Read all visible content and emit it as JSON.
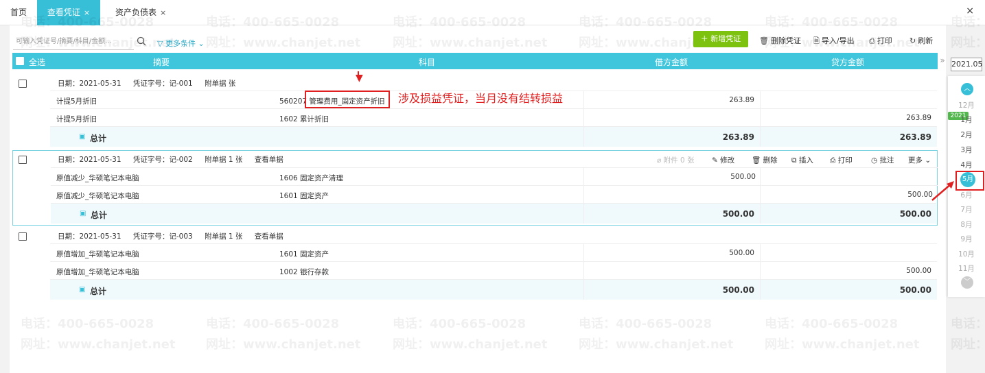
{
  "tabs": {
    "home": "首页",
    "active": "查看凭证",
    "balance_sheet": "资产负债表",
    "close_glyph": "×"
  },
  "toolbar": {
    "search_placeholder": "可输入凭证号/摘要/科目/金额...",
    "more_conditions": "更多条件",
    "new_voucher": "＋ 新增凭证",
    "delete_voucher": "删除凭证",
    "import_export": "导入/导出",
    "print": "打印",
    "refresh": "刷新"
  },
  "table_header": {
    "select_all": "全选",
    "summary": "摘要",
    "account": "科目",
    "debit": "借方金额",
    "credit": "贷方金额"
  },
  "vouchers": [
    {
      "date": "日期：2021-05-31",
      "number": "凭证字号：记-001",
      "attach": "附单据  张",
      "view": "",
      "rows": [
        {
          "summary": "计提5月折旧",
          "account": "560207 管理费用_固定资产折旧",
          "debit": "263.89",
          "credit": ""
        },
        {
          "summary": "计提5月折旧",
          "account": "1602 累计折旧",
          "debit": "",
          "credit": "263.89"
        }
      ],
      "total_label": "总计",
      "total_debit": "263.89",
      "total_credit": "263.89"
    },
    {
      "date": "日期：2021-05-31",
      "number": "凭证字号：记-002",
      "attach": "附单据 1 张",
      "view": "查看单据",
      "rows": [
        {
          "summary": "原值减少_华硕笔记本电脑",
          "account": "1606 固定资产清理",
          "debit": "500.00",
          "credit": ""
        },
        {
          "summary": "原值减少_华硕笔记本电脑",
          "account": "1601 固定资产",
          "debit": "",
          "credit": "500.00"
        }
      ],
      "total_label": "总计",
      "total_debit": "500.00",
      "total_credit": "500.00"
    },
    {
      "date": "日期：2021-05-31",
      "number": "凭证字号：记-003",
      "attach": "附单据 1 张",
      "view": "查看单据",
      "rows": [
        {
          "summary": "原值增加_华硕笔记本电脑",
          "account": "1601 固定资产",
          "debit": "500.00",
          "credit": ""
        },
        {
          "summary": "原值增加_华硕笔记本电脑",
          "account": "1002 银行存款",
          "debit": "",
          "credit": "500.00"
        }
      ],
      "total_label": "总计",
      "total_debit": "500.00",
      "total_credit": "500.00"
    }
  ],
  "row_actions": {
    "attachment": "附件 0 张",
    "edit": "修改",
    "delete": "删除",
    "insert": "插入",
    "print": "打印",
    "annotate": "批注",
    "more": "更多"
  },
  "annotation": "涉及损益凭证，当月没有结转损益",
  "period": {
    "year": "2021.05",
    "year_badge": "2021",
    "prev_year_month": "12月",
    "months": [
      "1月",
      "2月",
      "3月",
      "4月",
      "5月",
      "6月",
      "7月",
      "8月",
      "9月",
      "10月",
      "11月"
    ],
    "selected": "5月"
  },
  "watermark": {
    "phone": "电话：400-665-0028",
    "site": "网址：www.chanjet.net"
  },
  "colors": {
    "header": "#3fc6dc",
    "accent": "#37bfd8",
    "new_button": "#7cc20f",
    "annotation": "#e02020"
  }
}
